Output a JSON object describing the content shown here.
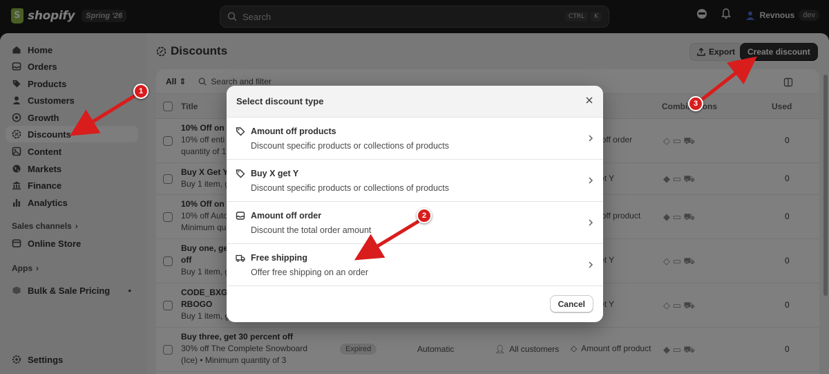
{
  "topbar": {
    "logo_text": "shopify",
    "logo_badge": "Spring '26",
    "search_placeholder": "Search",
    "kbd_ctrl": "CTRL",
    "kbd_k": "K",
    "user_name": "Revnous",
    "user_badge": "dev"
  },
  "sidebar": {
    "items": [
      {
        "label": "Home"
      },
      {
        "label": "Orders"
      },
      {
        "label": "Products"
      },
      {
        "label": "Customers"
      },
      {
        "label": "Growth"
      },
      {
        "label": "Discounts"
      },
      {
        "label": "Content"
      },
      {
        "label": "Markets"
      },
      {
        "label": "Finance"
      },
      {
        "label": "Analytics"
      }
    ],
    "sales_channels": "Sales channels",
    "online_store": "Online Store",
    "apps": "Apps",
    "bulk_sale": "Bulk & Sale Pricing",
    "bulk_dot": "•",
    "settings": "Settings"
  },
  "page": {
    "title": "Discounts",
    "export_label": "Export",
    "create_label": "Create discount"
  },
  "table": {
    "filter_all": "All",
    "search_filter": "Search and filter",
    "col_title": "Title",
    "col_combinations": "Combinations",
    "col_used": "Used",
    "rows": [
      {
        "title": "10% Off on 1",
        "sub1": "10% off enti",
        "sub2": "quantity of 1",
        "type": "Amount off order",
        "used": "0"
      },
      {
        "title": "Buy X Get Y",
        "sub1": "Buy 1 item, g",
        "type": "Buy X get Y",
        "used": "0"
      },
      {
        "title": "10% Off on A",
        "sub1": "10% off Auto",
        "sub2": "Minimum qua",
        "type": "Amount off product",
        "used": "0"
      },
      {
        "title": "Buy one, get",
        "title2": "off",
        "sub1": "Buy 1 item, g",
        "type": "Buy X get Y",
        "used": "0"
      },
      {
        "title": "CODE_BXGY",
        "title2": "RBOGO",
        "sub1": "Buy 1 item, g",
        "type": "Buy X get Y",
        "used": "0"
      },
      {
        "title": "Buy three, get 30 percent off",
        "sub1": "30% off The Complete Snowboard",
        "sub2": "(Ice) • Minimum quantity of 3",
        "status": "Expired",
        "method": "Automatic",
        "eligibility": "All customers",
        "type": "Amount off product",
        "used": "0"
      }
    ]
  },
  "modal": {
    "title": "Select discount type",
    "options": [
      {
        "label": "Amount off products",
        "desc": "Discount specific products or collections of products",
        "icon": "tag-icon"
      },
      {
        "label": "Buy X get Y",
        "desc": "Discount specific products or collections of products",
        "icon": "tag-icon"
      },
      {
        "label": "Amount off order",
        "desc": "Discount the total order amount",
        "icon": "inbox-icon"
      },
      {
        "label": "Free shipping",
        "desc": "Offer free shipping on an order",
        "icon": "truck-icon"
      }
    ],
    "cancel_label": "Cancel"
  },
  "annotations": {
    "markers": [
      "1",
      "2",
      "3"
    ],
    "color": "#d91c1c"
  }
}
